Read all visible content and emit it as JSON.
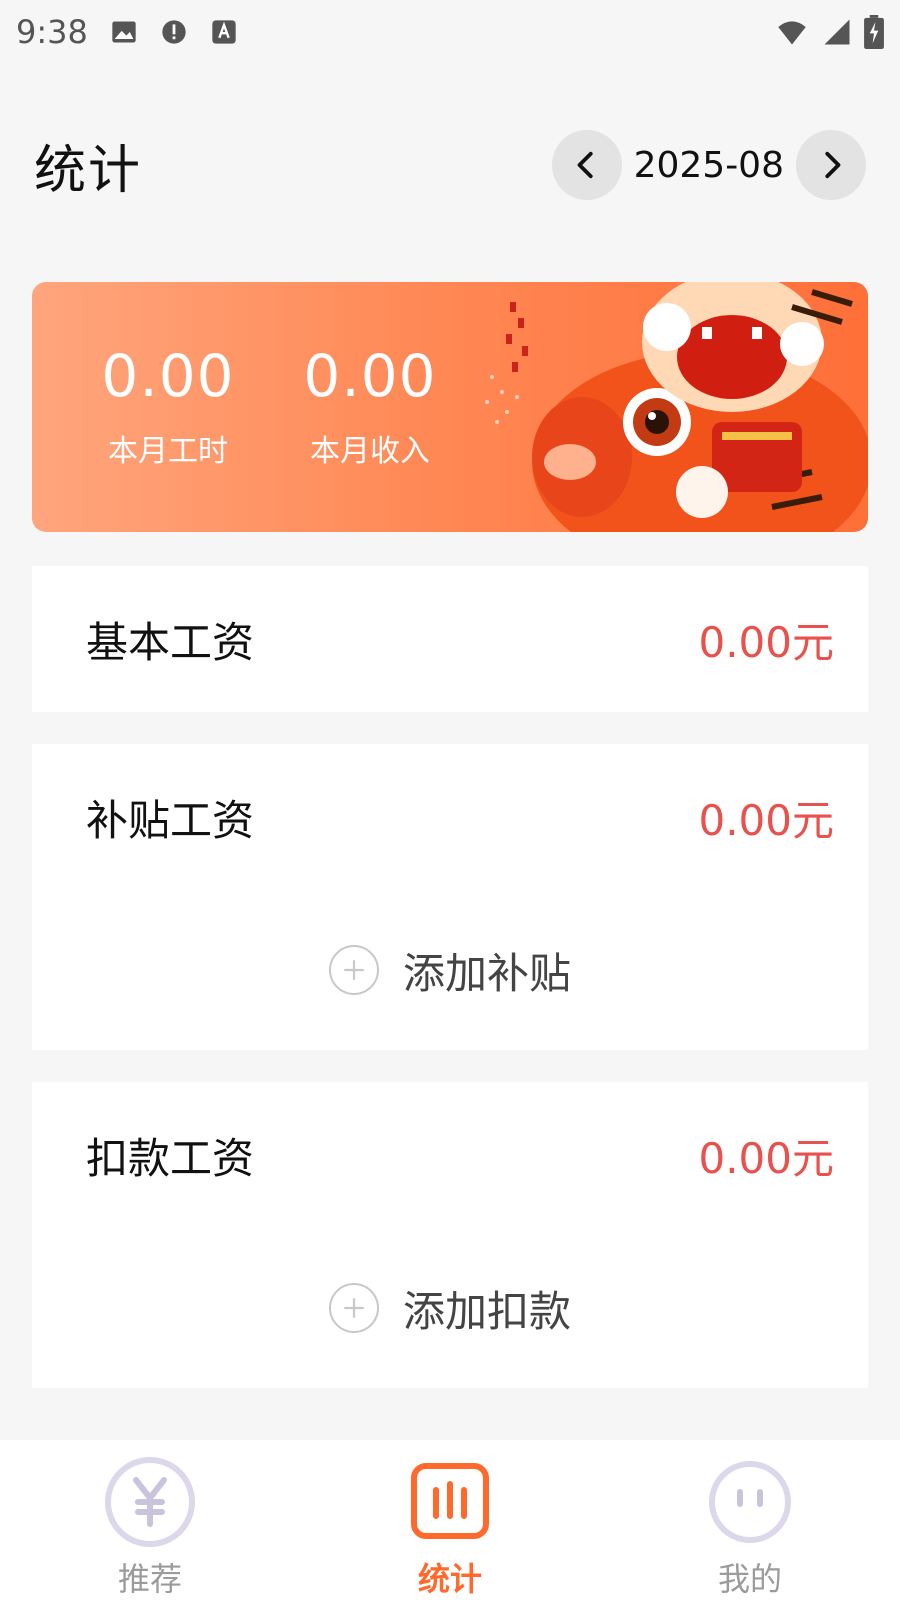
{
  "status_bar": {
    "time": "9:38",
    "icons_left": [
      "image-icon",
      "alert-icon",
      "text-a-icon"
    ],
    "icons_right": [
      "wifi-icon",
      "signal-icon",
      "battery-icon"
    ]
  },
  "header": {
    "title": "统计",
    "month": "2025-08",
    "prev_icon": "chevron-left-icon",
    "next_icon": "chevron-right-icon"
  },
  "summary": {
    "hours_value": "0.00",
    "hours_label": "本月工时",
    "income_value": "0.00",
    "income_label": "本月收入"
  },
  "basic_salary": {
    "label": "基本工资",
    "amount": "0.00元"
  },
  "subsidy": {
    "label": "补贴工资",
    "amount": "0.00元",
    "add_label": "添加补贴"
  },
  "deduction": {
    "label": "扣款工资",
    "amount": "0.00元",
    "add_label": "添加扣款"
  },
  "tabbar": {
    "tabs": [
      {
        "label": "推荐",
        "icon": "yen-icon",
        "active": false
      },
      {
        "label": "统计",
        "icon": "chart-icon",
        "active": true
      },
      {
        "label": "我的",
        "icon": "face-icon",
        "active": false
      }
    ]
  },
  "colors": {
    "accent": "#ff6a2c",
    "amount": "#e8514d",
    "banner_start": "#ffa57d",
    "banner_end": "#ff6f38"
  }
}
